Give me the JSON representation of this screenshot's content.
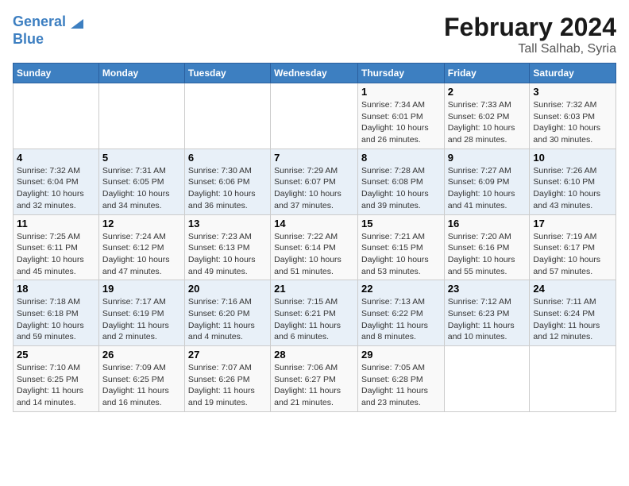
{
  "header": {
    "logo_line1": "General",
    "logo_line2": "Blue",
    "month": "February 2024",
    "location": "Tall Salhab, Syria"
  },
  "weekdays": [
    "Sunday",
    "Monday",
    "Tuesday",
    "Wednesday",
    "Thursday",
    "Friday",
    "Saturday"
  ],
  "weeks": [
    [
      {
        "day": "",
        "info": ""
      },
      {
        "day": "",
        "info": ""
      },
      {
        "day": "",
        "info": ""
      },
      {
        "day": "",
        "info": ""
      },
      {
        "day": "1",
        "info": "Sunrise: 7:34 AM\nSunset: 6:01 PM\nDaylight: 10 hours\nand 26 minutes."
      },
      {
        "day": "2",
        "info": "Sunrise: 7:33 AM\nSunset: 6:02 PM\nDaylight: 10 hours\nand 28 minutes."
      },
      {
        "day": "3",
        "info": "Sunrise: 7:32 AM\nSunset: 6:03 PM\nDaylight: 10 hours\nand 30 minutes."
      }
    ],
    [
      {
        "day": "4",
        "info": "Sunrise: 7:32 AM\nSunset: 6:04 PM\nDaylight: 10 hours\nand 32 minutes."
      },
      {
        "day": "5",
        "info": "Sunrise: 7:31 AM\nSunset: 6:05 PM\nDaylight: 10 hours\nand 34 minutes."
      },
      {
        "day": "6",
        "info": "Sunrise: 7:30 AM\nSunset: 6:06 PM\nDaylight: 10 hours\nand 36 minutes."
      },
      {
        "day": "7",
        "info": "Sunrise: 7:29 AM\nSunset: 6:07 PM\nDaylight: 10 hours\nand 37 minutes."
      },
      {
        "day": "8",
        "info": "Sunrise: 7:28 AM\nSunset: 6:08 PM\nDaylight: 10 hours\nand 39 minutes."
      },
      {
        "day": "9",
        "info": "Sunrise: 7:27 AM\nSunset: 6:09 PM\nDaylight: 10 hours\nand 41 minutes."
      },
      {
        "day": "10",
        "info": "Sunrise: 7:26 AM\nSunset: 6:10 PM\nDaylight: 10 hours\nand 43 minutes."
      }
    ],
    [
      {
        "day": "11",
        "info": "Sunrise: 7:25 AM\nSunset: 6:11 PM\nDaylight: 10 hours\nand 45 minutes."
      },
      {
        "day": "12",
        "info": "Sunrise: 7:24 AM\nSunset: 6:12 PM\nDaylight: 10 hours\nand 47 minutes."
      },
      {
        "day": "13",
        "info": "Sunrise: 7:23 AM\nSunset: 6:13 PM\nDaylight: 10 hours\nand 49 minutes."
      },
      {
        "day": "14",
        "info": "Sunrise: 7:22 AM\nSunset: 6:14 PM\nDaylight: 10 hours\nand 51 minutes."
      },
      {
        "day": "15",
        "info": "Sunrise: 7:21 AM\nSunset: 6:15 PM\nDaylight: 10 hours\nand 53 minutes."
      },
      {
        "day": "16",
        "info": "Sunrise: 7:20 AM\nSunset: 6:16 PM\nDaylight: 10 hours\nand 55 minutes."
      },
      {
        "day": "17",
        "info": "Sunrise: 7:19 AM\nSunset: 6:17 PM\nDaylight: 10 hours\nand 57 minutes."
      }
    ],
    [
      {
        "day": "18",
        "info": "Sunrise: 7:18 AM\nSunset: 6:18 PM\nDaylight: 10 hours\nand 59 minutes."
      },
      {
        "day": "19",
        "info": "Sunrise: 7:17 AM\nSunset: 6:19 PM\nDaylight: 11 hours\nand 2 minutes."
      },
      {
        "day": "20",
        "info": "Sunrise: 7:16 AM\nSunset: 6:20 PM\nDaylight: 11 hours\nand 4 minutes."
      },
      {
        "day": "21",
        "info": "Sunrise: 7:15 AM\nSunset: 6:21 PM\nDaylight: 11 hours\nand 6 minutes."
      },
      {
        "day": "22",
        "info": "Sunrise: 7:13 AM\nSunset: 6:22 PM\nDaylight: 11 hours\nand 8 minutes."
      },
      {
        "day": "23",
        "info": "Sunrise: 7:12 AM\nSunset: 6:23 PM\nDaylight: 11 hours\nand 10 minutes."
      },
      {
        "day": "24",
        "info": "Sunrise: 7:11 AM\nSunset: 6:24 PM\nDaylight: 11 hours\nand 12 minutes."
      }
    ],
    [
      {
        "day": "25",
        "info": "Sunrise: 7:10 AM\nSunset: 6:25 PM\nDaylight: 11 hours\nand 14 minutes."
      },
      {
        "day": "26",
        "info": "Sunrise: 7:09 AM\nSunset: 6:25 PM\nDaylight: 11 hours\nand 16 minutes."
      },
      {
        "day": "27",
        "info": "Sunrise: 7:07 AM\nSunset: 6:26 PM\nDaylight: 11 hours\nand 19 minutes."
      },
      {
        "day": "28",
        "info": "Sunrise: 7:06 AM\nSunset: 6:27 PM\nDaylight: 11 hours\nand 21 minutes."
      },
      {
        "day": "29",
        "info": "Sunrise: 7:05 AM\nSunset: 6:28 PM\nDaylight: 11 hours\nand 23 minutes."
      },
      {
        "day": "",
        "info": ""
      },
      {
        "day": "",
        "info": ""
      }
    ]
  ]
}
